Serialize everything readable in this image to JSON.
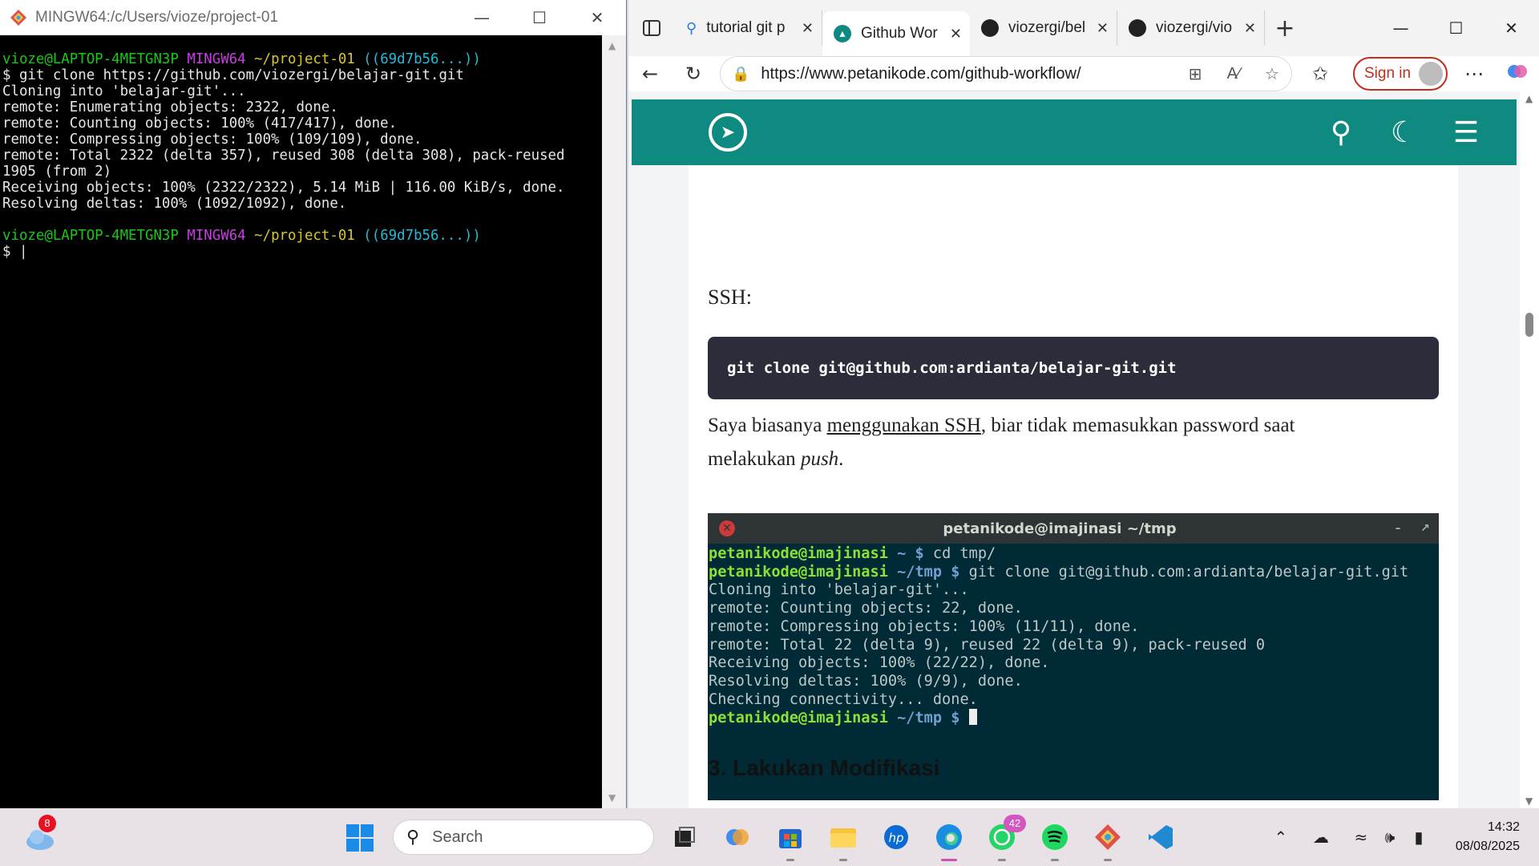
{
  "terminal": {
    "title": "MINGW64:/c/Users/vioze/project-01",
    "prompt1": {
      "user": "vioze@LAPTOP-4METGN3P",
      "shell": "MINGW64",
      "path": "~/project-01",
      "branch": "((69d7b56...))"
    },
    "command": "$ git clone https://github.com/viozergi/belajar-git.git",
    "output": [
      "Cloning into 'belajar-git'...",
      "remote: Enumerating objects: 2322, done.",
      "remote: Counting objects: 100% (417/417), done.",
      "remote: Compressing objects: 100% (109/109), done.",
      "remote: Total 2322 (delta 357), reused 308 (delta 308), pack-reused",
      "1905 (from 2)",
      "Receiving objects: 100% (2322/2322), 5.14 MiB | 116.00 KiB/s, done.",
      "Resolving deltas: 100% (1092/1092), done."
    ],
    "prompt2": {
      "user": "vioze@LAPTOP-4METGN3P",
      "shell": "MINGW64",
      "path": "~/project-01",
      "branch": "((69d7b56...))"
    },
    "cursor_line": "$ |"
  },
  "browser": {
    "tabs": [
      {
        "label": "tutorial git p",
        "icon": "search-icon"
      },
      {
        "label": "Github Wor",
        "icon": "petanikode-icon",
        "active": true
      },
      {
        "label": "viozergi/bel",
        "icon": "github-icon"
      },
      {
        "label": "viozergi/vio",
        "icon": "github-icon"
      }
    ],
    "url": "https://www.petanikode.com/github-workflow/",
    "signin_label": "Sign in"
  },
  "article": {
    "ssh_label": "SSH:",
    "code": "git clone git@github.com:ardianta/belajar-git.git",
    "para_before": "Saya biasanya ",
    "para_link": "menggunakan SSH",
    "para_after": ", biar tidak memasukkan password saat",
    "para_line2_before": "melakukan ",
    "para_line2_em": "push",
    "para_line2_after": ".",
    "screenshot": {
      "title": "petanikode@imajinasi ~/tmp",
      "line1_prompt": "petanikode@imajinasi",
      "line1_path": "~ $",
      "line1_cmd": " cd tmp/",
      "line2_prompt": "petanikode@imajinasi",
      "line2_path": "~/tmp $",
      "line2_cmd": " git clone git@github.com:ardianta/belajar-git.git",
      "output": [
        "Cloning into 'belajar-git'...",
        "remote: Counting objects: 22, done.",
        "remote: Compressing objects: 100% (11/11), done.",
        "remote: Total 22 (delta 9), reused 22 (delta 9), pack-reused 0",
        "Receiving objects: 100% (22/22), done.",
        "Resolving deltas: 100% (9/9), done.",
        "Checking connectivity... done."
      ],
      "line_last_prompt": "petanikode@imajinasi",
      "line_last_path": "~/tmp $"
    },
    "heading": "3. Lakukan Modifikasi"
  },
  "taskbar": {
    "weather_badge": "8",
    "search_placeholder": "Search",
    "whatsapp_badge": "42",
    "time": "14:32",
    "date": "08/08/2025"
  },
  "colors": {
    "site_header": "#0f8a80",
    "code_bg": "#2b2d3a",
    "terminal_bg": "#002b36",
    "signin_red": "#c42b1c"
  }
}
